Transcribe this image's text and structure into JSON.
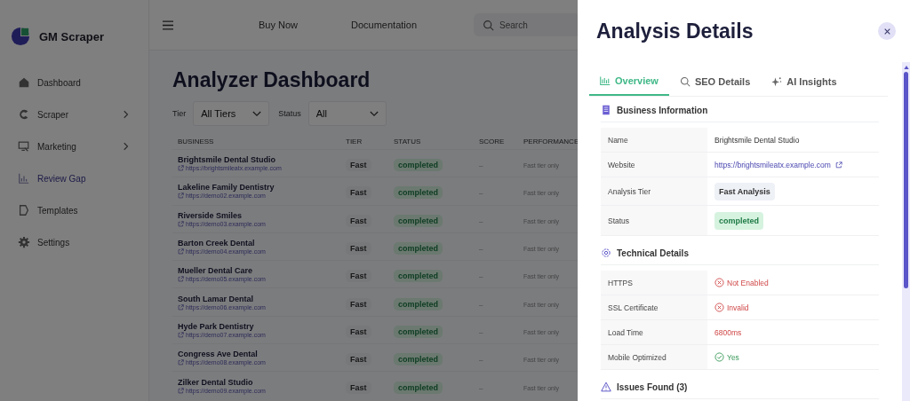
{
  "sidebar": {
    "brand": "GM Scraper",
    "items": [
      {
        "label": "Dashboard",
        "expandable": false,
        "selected": false
      },
      {
        "label": "Scraper",
        "expandable": true,
        "selected": false
      },
      {
        "label": "Marketing",
        "expandable": true,
        "selected": false
      },
      {
        "label": "Review Gap",
        "expandable": false,
        "selected": true
      },
      {
        "label": "Templates",
        "expandable": false,
        "selected": false
      },
      {
        "label": "Settings",
        "expandable": false,
        "selected": false
      }
    ]
  },
  "topbar": {
    "links": [
      "Buy Now",
      "Documentation"
    ],
    "search": {
      "placeholder": "Search"
    }
  },
  "page_title": "Analyzer Dashboard",
  "filters": [
    {
      "label": "Tier",
      "value": "All Tiers"
    },
    {
      "label": "Status",
      "value": "All"
    }
  ],
  "table": {
    "columns": [
      "BUSINESS",
      "TIER",
      "STATUS",
      "SCORE",
      "PERFORMANCE"
    ],
    "rows": [
      {
        "name": "Brightsmile Dental Studio",
        "url": "https://brightsmileatx.example.com",
        "tier": "Fast",
        "status": "completed",
        "score": "–",
        "performance": "Fast tier only"
      },
      {
        "name": "Lakeline Family Dentistry",
        "url": "https://demo02.example.com",
        "tier": "Fast",
        "status": "completed",
        "score": "–",
        "performance": "Fast tier only"
      },
      {
        "name": "Riverside Smiles",
        "url": "https://demo03.example.com",
        "tier": "Fast",
        "status": "completed",
        "score": "–",
        "performance": "Fast tier only"
      },
      {
        "name": "Barton Creek Dental",
        "url": "https://demo04.example.com",
        "tier": "Fast",
        "status": "completed",
        "score": "–",
        "performance": "Fast tier only"
      },
      {
        "name": "Mueller Dental Care",
        "url": "https://demo05.example.com",
        "tier": "Fast",
        "status": "completed",
        "score": "–",
        "performance": "Fast tier only"
      },
      {
        "name": "South Lamar Dental",
        "url": "https://demo06.example.com",
        "tier": "Fast",
        "status": "completed",
        "score": "–",
        "performance": "Fast tier only"
      },
      {
        "name": "Hyde Park Dentistry",
        "url": "https://demo07.example.com",
        "tier": "Fast",
        "status": "completed",
        "score": "–",
        "performance": "Fast tier only"
      },
      {
        "name": "Congress Ave Dental",
        "url": "https://demo08.example.com",
        "tier": "Fast",
        "status": "completed",
        "score": "–",
        "performance": "Fast tier only"
      },
      {
        "name": "Zilker Dental Studio",
        "url": "https://demo09.example.com",
        "tier": "Fast",
        "status": "completed",
        "score": "–",
        "performance": "Fast tier only"
      }
    ]
  },
  "drawer": {
    "title": "Analysis Details",
    "tabs": [
      {
        "label": "Overview",
        "selected": true
      },
      {
        "label": "SEO Details",
        "selected": false
      },
      {
        "label": "AI Insights",
        "selected": false
      }
    ],
    "sections": [
      {
        "title": "Business Information",
        "rows": [
          {
            "label": "Name",
            "value": "Brightsmile Dental Studio",
            "kind": "text"
          },
          {
            "label": "Website",
            "value": "https://brightsmileatx.example.com",
            "kind": "link"
          },
          {
            "label": "Analysis Tier",
            "value": "Fast Analysis",
            "kind": "tier"
          },
          {
            "label": "Status",
            "value": "completed",
            "kind": "status"
          }
        ]
      },
      {
        "title": "Technical Details",
        "rows": [
          {
            "label": "HTTPS",
            "value": "Not Enabled",
            "kind": "fail"
          },
          {
            "label": "SSL Certificate",
            "value": "Invalid",
            "kind": "fail"
          },
          {
            "label": "Load Time",
            "value": "6800ms",
            "kind": "bad"
          },
          {
            "label": "Mobile Optimized",
            "value": "Yes",
            "kind": "pass"
          }
        ]
      },
      {
        "title": "Issues Found (3)"
      }
    ]
  }
}
